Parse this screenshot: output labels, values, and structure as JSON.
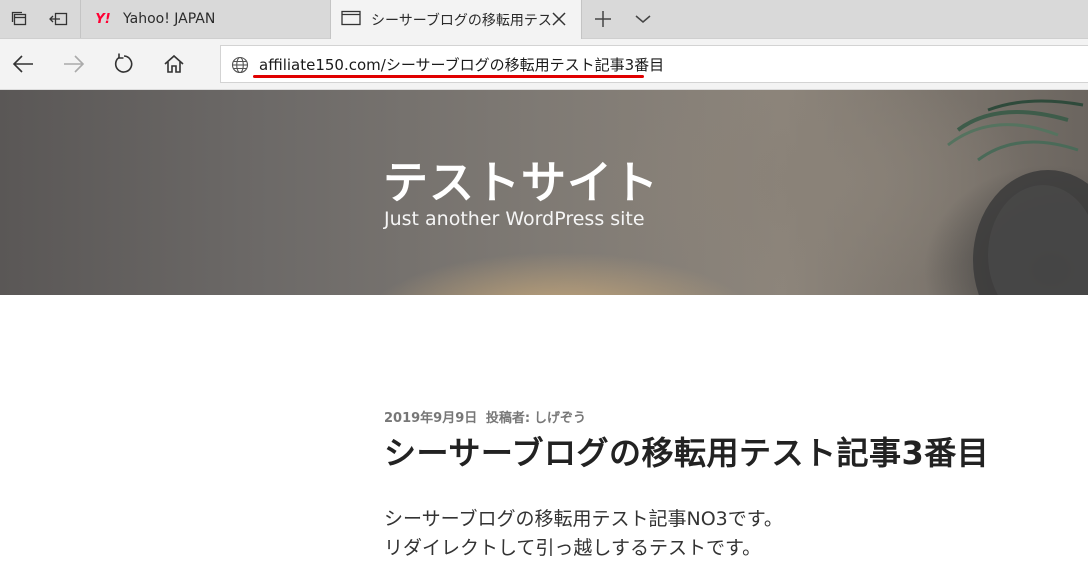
{
  "browser": {
    "tabs": [
      {
        "title": "Yahoo! JAPAN",
        "favicon": "yahoo-logo",
        "favicon_text": "Y!",
        "active": false
      },
      {
        "title": "シーサーブログの移転用テス",
        "favicon": "page-icon",
        "active": true
      }
    ],
    "address": {
      "url": "affiliate150.com/シーサーブログの移転用テスト記事3番目",
      "highlight_color": "#e00000"
    }
  },
  "site": {
    "title": "テストサイト",
    "tagline": "Just another WordPress site"
  },
  "post": {
    "date": "2019年9月9日",
    "author_label": "投稿者:",
    "author": "しげぞう",
    "title": "シーサーブログの移転用テスト記事3番目",
    "body": [
      "シーサーブログの移転用テスト記事NO3です。",
      "リダイレクトして引っ越しするテストです。"
    ]
  }
}
